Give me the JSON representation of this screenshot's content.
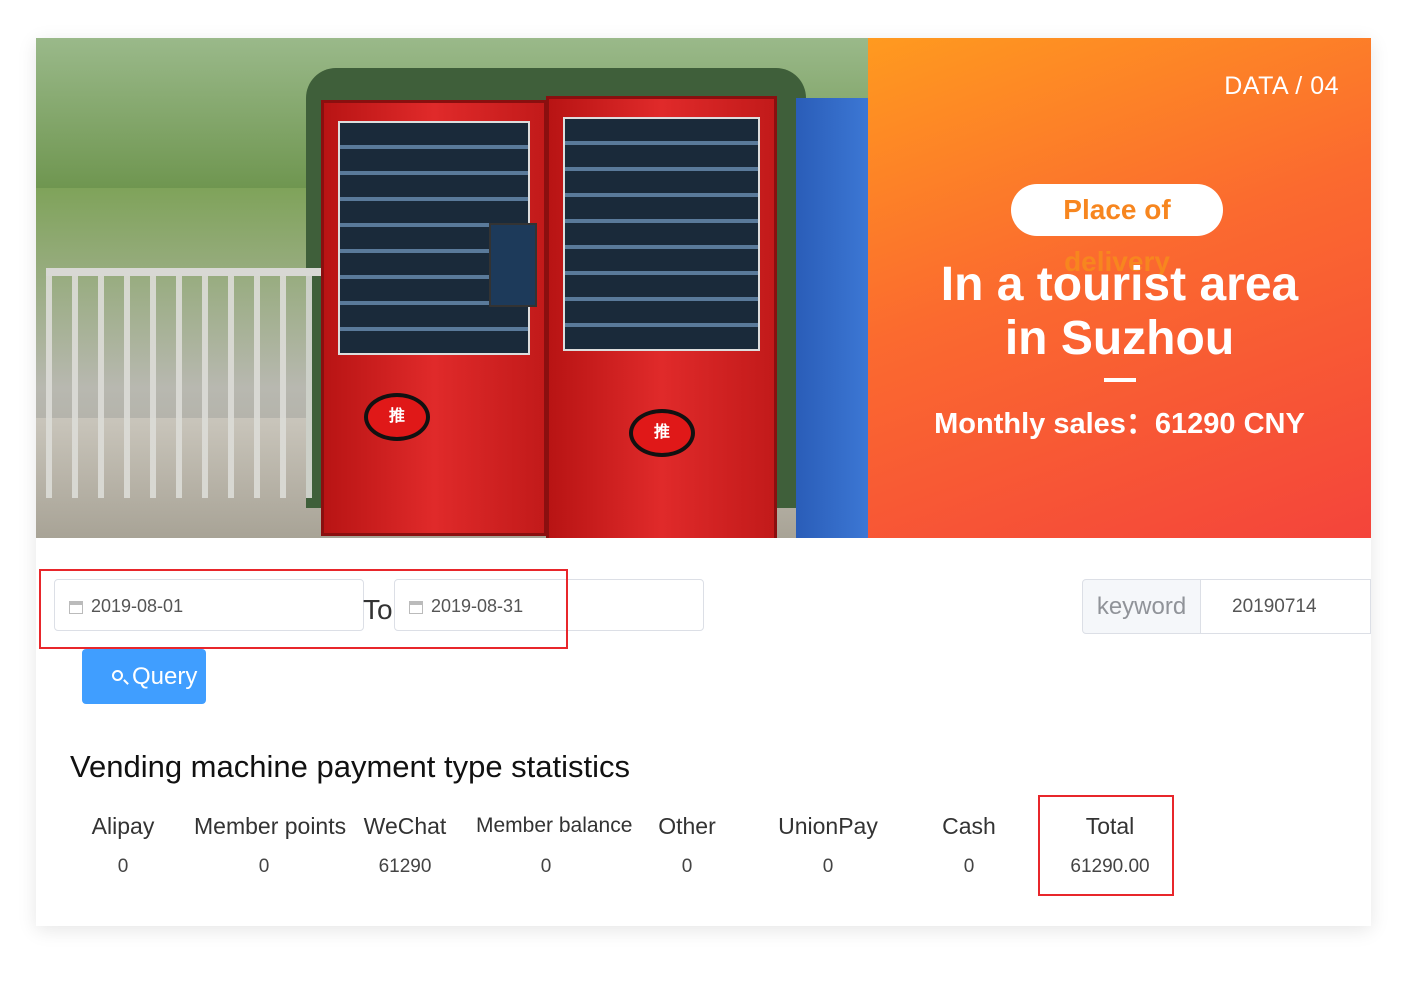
{
  "banner": {
    "tag": "DATA / 04",
    "pill": "Place of delivery",
    "headline_line1": "In a tourist area",
    "headline_line2": "in Suzhou",
    "sales": "Monthly sales：61290 CNY",
    "colors": {
      "gradient_start": "#ff9a1f",
      "gradient_end": "#f4443b",
      "pill_text": "#f7861f"
    }
  },
  "filters": {
    "start_date": "2019-08-01",
    "to_label": "To",
    "end_date": "2019-08-31",
    "keyword_label": "keyword",
    "keyword_value": "20190714",
    "query_label": "Query"
  },
  "stats": {
    "title": "Vending machine payment type statistics",
    "columns": [
      {
        "label": "Alipay",
        "value": "0"
      },
      {
        "label": "Member points",
        "value": "0"
      },
      {
        "label": "WeChat",
        "value": "61290"
      },
      {
        "label": "Member balance",
        "value": "0"
      },
      {
        "label": "Other",
        "value": "0"
      },
      {
        "label": "UnionPay",
        "value": "0"
      },
      {
        "label": "Cash",
        "value": "0"
      },
      {
        "label": "Total",
        "value": "61290.00"
      }
    ]
  },
  "colors": {
    "query_button": "#409eff",
    "highlight_border": "#e8262b"
  }
}
